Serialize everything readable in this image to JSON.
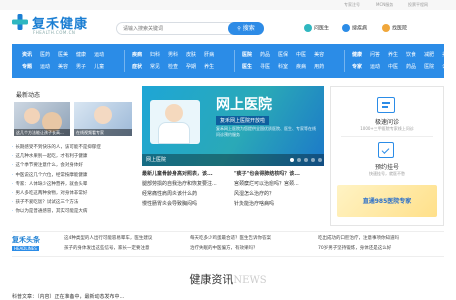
{
  "topbar": {
    "links": [
      "专家注号",
      "MCN服务",
      "投票平程网"
    ]
  },
  "logo": {
    "name": "复禾健康",
    "sub": "FHEALTH.COM.CN"
  },
  "search": {
    "placeholder": "请输入搜索关键词",
    "button": "搜索"
  },
  "quick": {
    "doctor": "问医生",
    "hospital": "搜疾病",
    "pharmacy": "找医院"
  },
  "nav": {
    "col1": {
      "row1": [
        "资讯",
        "医药",
        "医美",
        "健康",
        "运动"
      ],
      "row2": [
        "专题",
        "运动",
        "美容",
        "男子",
        "儿童"
      ]
    },
    "col2": {
      "row1": [
        "疾病",
        "妇科",
        "男科",
        "皮肤",
        "肝病"
      ],
      "row2": [
        "症状",
        "常见",
        "检查",
        "孕期",
        "养生"
      ]
    },
    "col3": {
      "row1": [
        "医院",
        "药品",
        "医保",
        "中医",
        "美容"
      ],
      "row2": [
        "医生",
        "寻医",
        "科室",
        "疾病",
        "用药"
      ]
    },
    "col4": {
      "row1": [
        "健康",
        "问答",
        "养生",
        "饮食",
        "减肥",
        "美容"
      ],
      "row2": [
        "专家",
        "运动",
        "中医",
        "药品",
        "医院",
        "公卫"
      ]
    }
  },
  "left": {
    "title": "最新动态",
    "thumb1_caption": "这几个方法能让孩子长高...",
    "thumb2_caption": "在线视频看专家",
    "items": [
      "长期感受不到快乐的人，该可能不是抑郁症",
      "这几种水果别一起吃，才有利于健康",
      "这个季节要注意什么，会对身体好",
      "中医说这几个穴位，经常按摩能健康",
      "专家：人体缺少这种营养，就会头晕",
      "男人多吃这两种食物，对身体非常好",
      "孩子不爱吃饭？试试这三个方法",
      "你以为是普通感冒，其实可能是大病"
    ]
  },
  "banner": {
    "title": "网上医院",
    "subtitle": "复禾网上医院开放啦",
    "desc": "复禾网上医院为您提供全国优质医院、医生、专家等在线问诊预约服务",
    "caption": "网上医院",
    "dots": 5
  },
  "center": {
    "rows": [
      [
        "最新儿童骨龄身高对照表，该...",
        "\"痰子\"也会得肺结核吗？该..."
      ],
      [
        "腿部劳损的自我治疗和恢复要注...",
        "宫颈糜烂可以治愈吗？宫颈..."
      ],
      [
        "经常痛性肩周炎该什么药",
        "风湿怎么治疗的？"
      ],
      [
        "慢性肠胃炎会导致胸闷吗",
        "针灸能治疗啥病吗"
      ]
    ]
  },
  "side": {
    "item1_title": "极速问诊",
    "item1_desc": "1000+三甲医院专家线上问诊",
    "item2_title": "预约挂号",
    "item2_desc": "快速挂号，就医不愁",
    "ad_text": "直通985医院专家"
  },
  "ticker": {
    "label": "复禾头条",
    "label_en": "HEADLINES",
    "col1": [
      "这4种类型的人出行可能容易晕车，医生建议",
      "孩子的身体发出这些信号，家长一定要注意"
    ],
    "col2": [
      "每天吃多少鸡蛋最合适？医生告诉你答案",
      "治疗失眠的中医偏方，有效果吗？"
    ],
    "col3": [
      "吃出成功的口腔治疗，注意事项你知道吗",
      "70岁男子坚持锻炼，身体还是这么好"
    ]
  },
  "news": {
    "title": "健康资讯",
    "title_en": "NEWS"
  },
  "bottom_peek": "科普文章：（内容）正在准备中，最新动态发布中..."
}
